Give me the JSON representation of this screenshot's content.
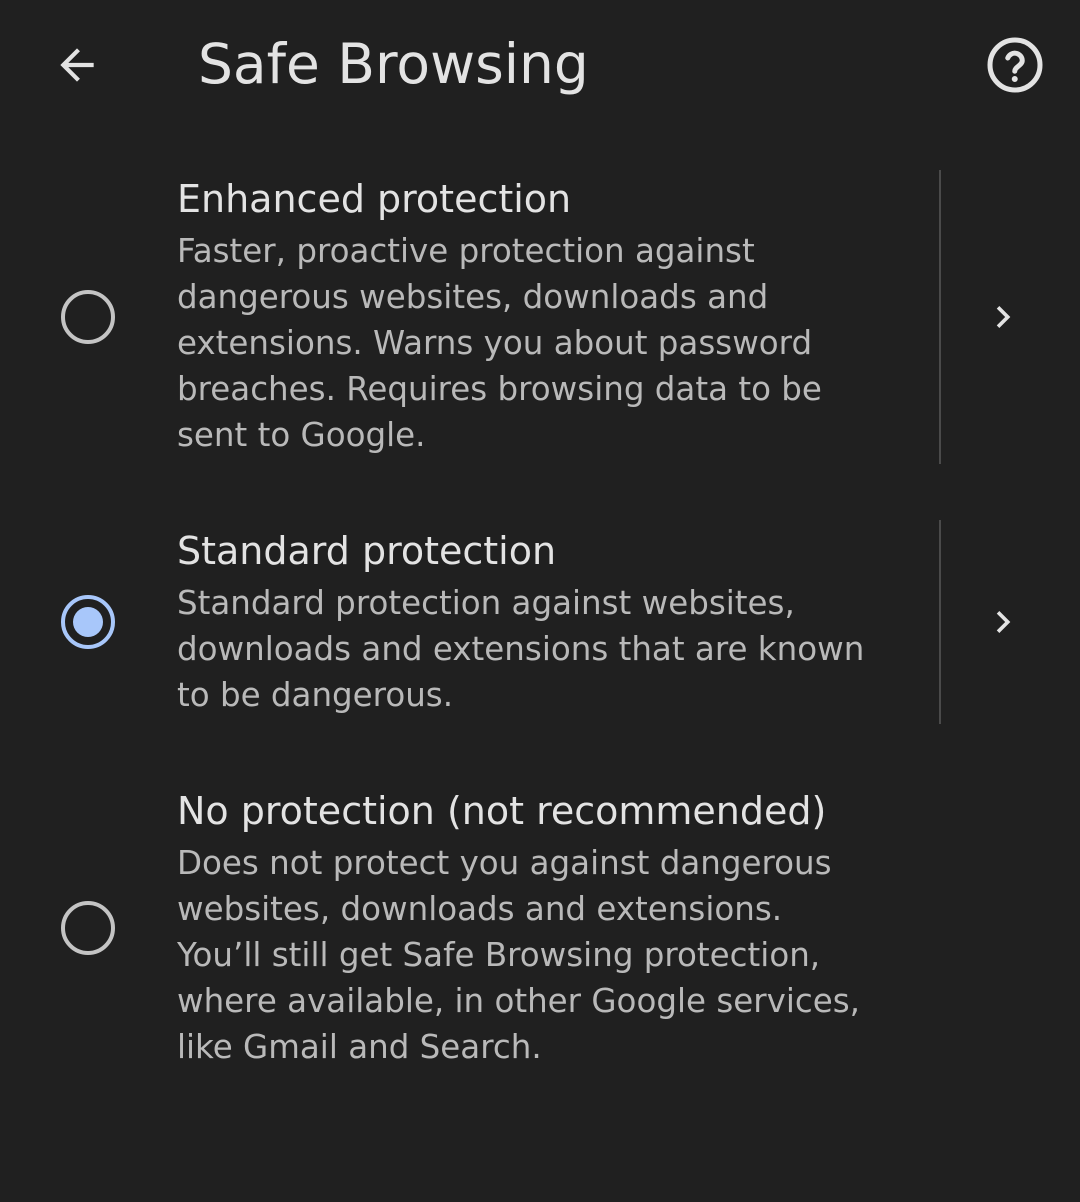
{
  "header": {
    "title": "Safe Browsing",
    "back_icon": "arrow-back-icon",
    "help_icon": "help-circle-icon"
  },
  "colors": {
    "background": "#202020",
    "primary_text": "#e3e3e3",
    "secondary_text": "#b9b9b9",
    "radio_selected": "#a8c7fa",
    "radio_unselected": "#c4c4c4",
    "divider": "#4a4a4a"
  },
  "options": [
    {
      "title": "Enhanced protection",
      "description_lines": [
        "Faster, proactive protection against",
        "dangerous websites, downloads and",
        "extensions. Warns you about password",
        "breaches. Requires browsing data to be",
        "sent to Google."
      ],
      "selected": false,
      "has_details": true
    },
    {
      "title": "Standard protection",
      "description_lines": [
        "Standard protection against websites,",
        "downloads and extensions that are known",
        "to be dangerous."
      ],
      "selected": true,
      "has_details": true
    },
    {
      "title": "No protection (not recommended)",
      "description_lines": [
        "Does not protect you against dangerous",
        "websites, downloads and extensions.",
        "You’ll still get Safe Browsing protection,",
        "where available, in other Google services,",
        "like Gmail and Search."
      ],
      "selected": false,
      "has_details": false
    }
  ]
}
